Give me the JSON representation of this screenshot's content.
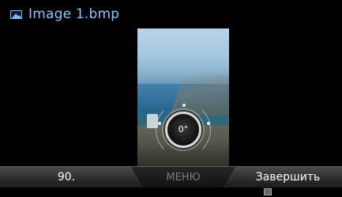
{
  "header": {
    "title": "Image 1.bmp",
    "icon": "image-file-icon"
  },
  "viewer": {
    "rotation_label": "0°"
  },
  "softkeys": {
    "left_label": "90.",
    "menu_label": "МЕНЮ",
    "right_label": "Завершить"
  },
  "footer": {
    "indicator_icon": "small-status-icon"
  },
  "colors": {
    "title_text": "#8cc4ff",
    "bar_top": "#4a4a4a",
    "bar_bottom": "#1b1b1b",
    "menu_text": "#7b7b7b"
  }
}
